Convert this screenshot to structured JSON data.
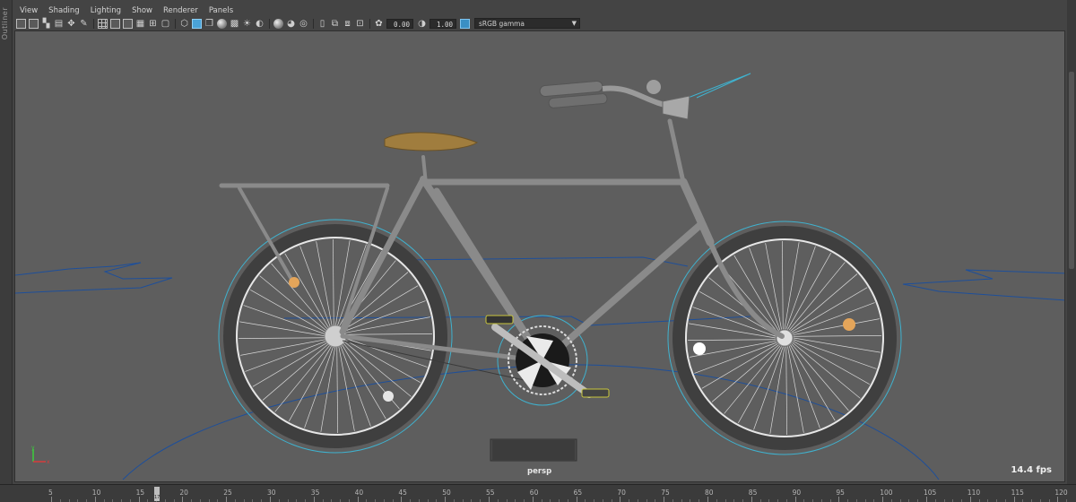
{
  "outliner": {
    "label": "Outliner"
  },
  "menu": [
    "View",
    "Shading",
    "Lighting",
    "Show",
    "Renderer",
    "Panels"
  ],
  "toolbar": {
    "exposure": "0.00",
    "gamma": "1.00",
    "color_space": "sRGB gamma",
    "icons": [
      "camera-select-icon",
      "camera-attributes-icon",
      "bookmark-icon",
      "image-plane-icon",
      "two-d-pan-icon",
      "grease-pencil-icon",
      "grid-icon",
      "film-gate-icon",
      "resolution-gate-icon",
      "gate-mask-icon",
      "field-chart-icon",
      "safe-action-icon",
      "wireframe-icon",
      "smooth-shade-icon",
      "bounding-box-icon",
      "flat-shade-icon",
      "textured-icon",
      "lighting-icon",
      "shadows-icon",
      "ambient-occlusion-icon",
      "motion-blur-icon",
      "anti-aliasing-icon",
      "depth-of-field-icon",
      "isolate-select-icon",
      "xray-icon",
      "xray-joints-icon",
      "xray-components-icon",
      "exposure-icon",
      "gamma-icon",
      "color-management-icon"
    ]
  },
  "viewport": {
    "camera_name": "persp",
    "fps": "14.4 fps",
    "axis_x": "x",
    "axis_y": "y"
  },
  "timeline": {
    "ticks": [
      "5",
      "10",
      "15",
      "20",
      "25",
      "30",
      "35",
      "40",
      "45",
      "50",
      "55",
      "60",
      "65",
      "70",
      "75",
      "80",
      "85",
      "90",
      "95",
      "100",
      "105",
      "110",
      "115",
      "120"
    ],
    "current_frame": "17"
  }
}
